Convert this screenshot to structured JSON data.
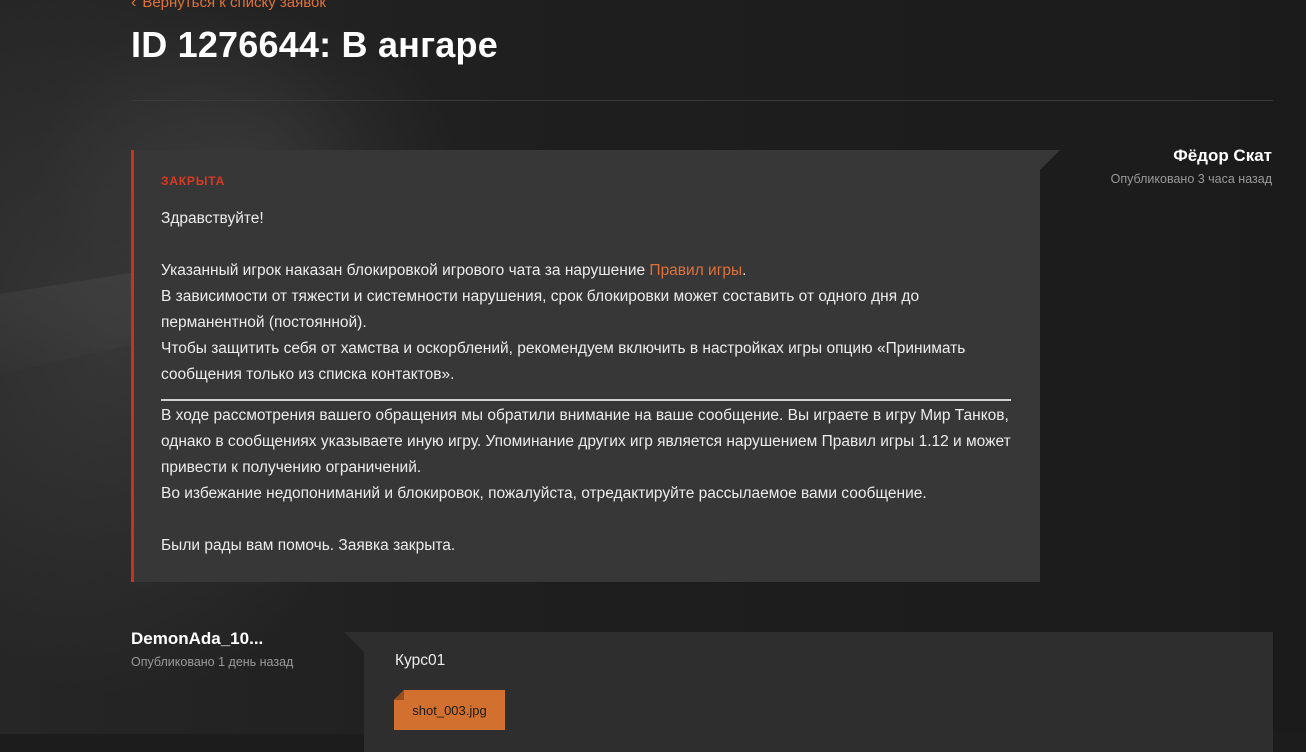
{
  "back_link": {
    "label": "Вернуться к списку заявок",
    "icon": "chevron-left-icon"
  },
  "page_title": "ID 1276644: В ангаре",
  "reply": {
    "status": "ЗАКРЫТА",
    "greeting": "Здравствуйте!",
    "para1_pre": "Указанный игрок наказан блокировкой игрового чата за нарушение ",
    "para1_link": "Правил игры",
    "para1_post": ".",
    "para2": "В зависимости от тяжести и системности нарушения, срок блокировки может составить от одного дня до перманентной (постоянной).",
    "para3": "Чтобы защитить себя от хамства и оскорблений, рекомендуем включить в настройках игры опцию «Принимать сообщения только из списка контактов».",
    "para4": "В ходе рассмотрения вашего обращения мы обратили внимание на ваше сообщение. Вы играете в игру Мир Танков, однако в сообщениях указываете иную игру. Упоминание других игр является нарушением Правил игры 1.12 и может привести к получению ограничений.",
    "para5": "Во избежание недопониманий и блокировок, пожалуйста, отредактируйте рассылаемое вами сообщение.",
    "closing": "Были рады вам помочь. Заявка закрыта.",
    "author": "Фёдор Скат",
    "published": "Опубликовано 3 часа назад"
  },
  "user_message": {
    "author": "DemonAda_10...",
    "published": "Опубликовано 1 день назад",
    "text": "Курс01",
    "attachment": "shot_003.jpg"
  },
  "colors": {
    "accent": "#e0713a",
    "status_red": "#d63a24",
    "card_bg": "#373737",
    "attachment_bg": "#d2712f"
  }
}
